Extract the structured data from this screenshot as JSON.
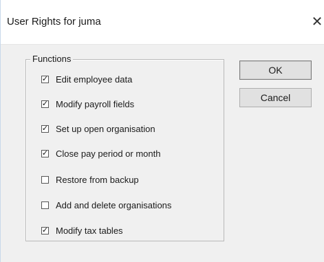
{
  "dialog": {
    "title": "User Rights for juma",
    "close_glyph": "✕"
  },
  "functions_group": {
    "legend": "Functions",
    "items": [
      {
        "label": "Edit employee data",
        "checked": true
      },
      {
        "label": "Modify payroll fields",
        "checked": true
      },
      {
        "label": "Set up open organisation",
        "checked": true
      },
      {
        "label": "Close pay period or month",
        "checked": true
      },
      {
        "label": "Restore from backup",
        "checked": false
      },
      {
        "label": "Add and delete organisations",
        "checked": false
      },
      {
        "label": "Modify tax tables",
        "checked": true
      }
    ]
  },
  "buttons": {
    "ok_label": "OK",
    "cancel_label": "Cancel"
  }
}
